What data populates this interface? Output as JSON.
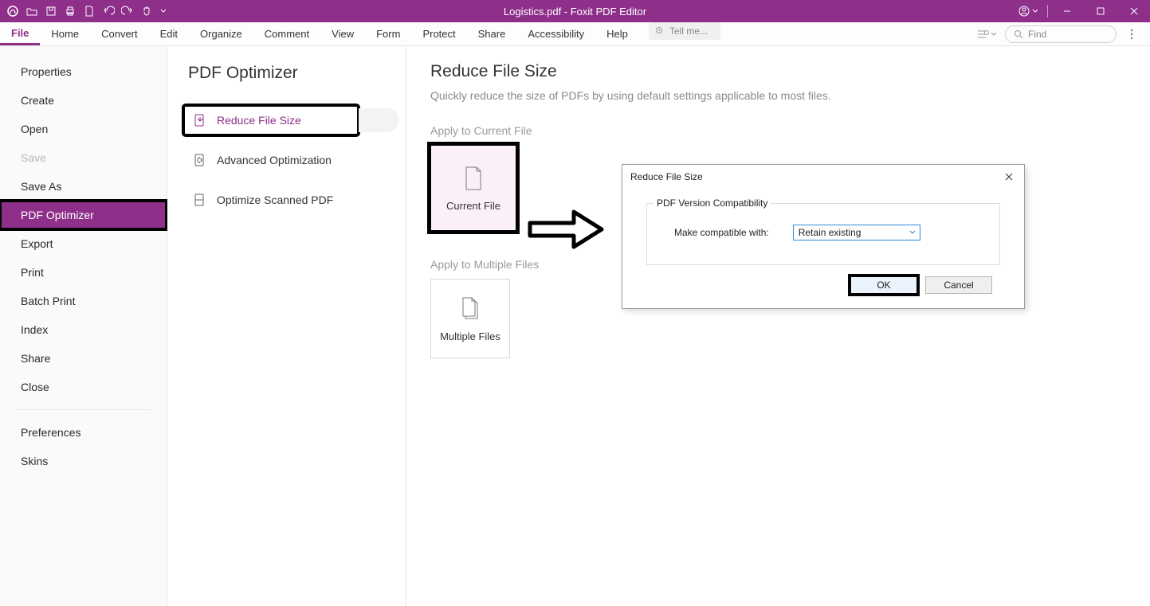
{
  "titlebar": {
    "title": "Logistics.pdf - Foxit PDF Editor"
  },
  "ribbon": {
    "tabs": [
      "File",
      "Home",
      "Convert",
      "Edit",
      "Organize",
      "Comment",
      "View",
      "Form",
      "Protect",
      "Share",
      "Accessibility",
      "Help"
    ],
    "tellme_placeholder": "Tell me...",
    "find_placeholder": "Find"
  },
  "file_menu": {
    "items": [
      {
        "label": "Properties",
        "state": ""
      },
      {
        "label": "Create",
        "state": ""
      },
      {
        "label": "Open",
        "state": ""
      },
      {
        "label": "Save",
        "state": "disabled"
      },
      {
        "label": "Save As",
        "state": ""
      },
      {
        "label": "PDF Optimizer",
        "state": "selected"
      },
      {
        "label": "Export",
        "state": ""
      },
      {
        "label": "Print",
        "state": ""
      },
      {
        "label": "Batch Print",
        "state": ""
      },
      {
        "label": "Index",
        "state": ""
      },
      {
        "label": "Share",
        "state": ""
      },
      {
        "label": "Close",
        "state": ""
      }
    ],
    "items2": [
      {
        "label": "Preferences"
      },
      {
        "label": "Skins"
      }
    ]
  },
  "options": {
    "title": "PDF Optimizer",
    "rows": [
      {
        "label": "Reduce File Size",
        "selected": true
      },
      {
        "label": "Advanced Optimization",
        "selected": false
      },
      {
        "label": "Optimize Scanned PDF",
        "selected": false
      }
    ]
  },
  "content": {
    "title": "Reduce File Size",
    "subtitle": "Quickly reduce the size of PDFs by using default settings applicable to most files.",
    "apply_current_label": "Apply to Current File",
    "tile_current": "Current File",
    "apply_multiple_label": "Apply to Multiple Files",
    "tile_multiple": "Multiple Files"
  },
  "dialog": {
    "title": "Reduce File Size",
    "fieldset_legend": "PDF Version Compatibility",
    "compat_label": "Make compatible with:",
    "compat_value": "Retain existing",
    "ok": "OK",
    "cancel": "Cancel"
  }
}
